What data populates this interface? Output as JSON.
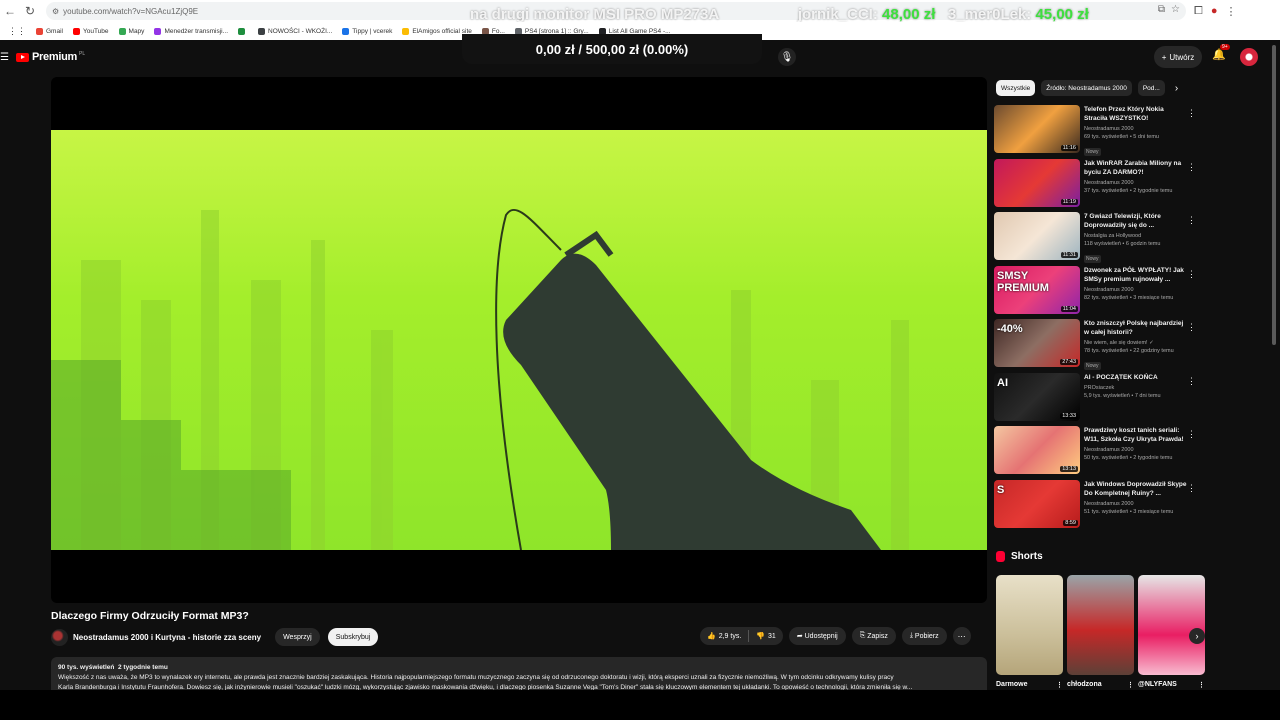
{
  "browser": {
    "url": "youtube.com/watch?v=NGAcu1ZjQ9E",
    "overlay_left": "na drugi monitor MSI PRO MP273A",
    "overlay_mid": "jornik_CCI:",
    "overlay_amount1": "48,00 zł",
    "overlay_name2": "3_mer0Lek:",
    "overlay_amount2": "45,00 zł",
    "bookmarks": [
      {
        "label": "Gmail",
        "color": "#ea4335"
      },
      {
        "label": "YouTube",
        "color": "#ff0000"
      },
      {
        "label": "Mapy",
        "color": "#34a853"
      },
      {
        "label": "Menedżer transmisji...",
        "color": "#9334e6"
      },
      {
        "label": "",
        "color": "#1e8e3e"
      },
      {
        "label": "NOWOŚCI - WKOŻI...",
        "color": "#3c4043"
      },
      {
        "label": "Tippy | vcerek",
        "color": "#1a73e8"
      },
      {
        "label": "ElAmigos official site",
        "color": "#fbbc04"
      },
      {
        "label": "Fo...",
        "color": "#795548"
      },
      {
        "label": "PS4 [strona 1] :: Gry...",
        "color": "#5f6368"
      },
      {
        "label": "List All Game PS4 -...",
        "color": "#202124"
      }
    ]
  },
  "donation": {
    "text": "0,00 zł / 500,00 zł (0.00%)"
  },
  "header": {
    "logo_text": "Premium",
    "logo_sup": "PL",
    "create_label": "Utwórz",
    "notif_badge": "9+"
  },
  "video": {
    "title": "Dlaczego Firmy Odrzuciły Format MP3?",
    "channel": "Neostradamus 2000 i Kurtyna - historie zza sceny",
    "support_label": "Wesprzyj",
    "subscribe_label": "Subskrybuj",
    "likes": "2,9 tys.",
    "dislikes": "31",
    "share_label": "Udostępnij",
    "save_label": "Zapisz",
    "download_label": "Pobierz",
    "views": "90 tys. wyświetleń",
    "age": "2 tygodnie temu",
    "description_1": "Większość z nas uważa, że MP3 to wynalazek ery internetu, ale prawda jest znacznie bardziej zaskakująca. Historia najpopularniejszego formatu muzycznego zaczyna się od odrzuconego doktoratu i wizji, którą eksperci uznali za fizycznie niemożliwą. W tym odcinku odkrywamy kulisy pracy",
    "description_2": "Karla Brandenburga i Instytutu Fraunhofera. Dowiesz się, jak inżynierowie musieli \"oszukać\" ludzki mózg, wykorzystując zjawisko maskowania dźwięku, i dlaczego piosenka Suzanne Vega \"Tom's Diner\" stała się kluczowym elementem tej układanki. To opowieść o technologii, która zmieniła się w..."
  },
  "chips": [
    "Wszystkie",
    "Źródło: Neostradamus 2000",
    "Pod..."
  ],
  "recommendations": [
    {
      "title": "Telefon Przez Który Nokia Straciła WSZYSTKO!",
      "channel": "Neostradamus 2000",
      "meta": "69 tys. wyświetleń • 5 dni temu",
      "badge": "Nowy",
      "duration": "11:16",
      "thumb_text": "",
      "thumb_bg": "linear-gradient(135deg,#6b4a2f,#f0a040 50%,#3a2a20)"
    },
    {
      "title": "Jak WinRAR Zarabia Miliony na byciu ZA DARMO?!",
      "channel": "Neostradamus 2000",
      "meta": "37 tys. wyświetleń • 2 tygodnie temu",
      "badge": "",
      "duration": "11:19",
      "thumb_text": "",
      "thumb_bg": "linear-gradient(135deg,#c2185b,#e53935 50%,#7b1fa2)"
    },
    {
      "title": "7 Gwiazd Telewizji, Które Doprowadziły się do ...",
      "channel": "Nostalgia za Hollywood",
      "meta": "118 wyświetleń • 6 godzin temu",
      "badge": "Nowy",
      "duration": "11:31",
      "thumb_text": "",
      "thumb_bg": "linear-gradient(135deg,#e0c8b0,#f5e6d6 50%,#9db4c0)"
    },
    {
      "title": "Dzwonek za PÓŁ WYPŁATY! Jak SMSy premium rujnowały ...",
      "channel": "Neostradamus 2000",
      "meta": "82 tys. wyświetleń • 3 miesiące temu",
      "badge": "",
      "duration": "11:04",
      "thumb_text": "SMSY PREMIUM",
      "thumb_bg": "linear-gradient(135deg,#d81b60,#ec407a 50%,#8e24aa)"
    },
    {
      "title": "Kto zniszczył Polskę najbardziej w całej historii?",
      "channel": "Nie wiem, ale się dowiem! ✓",
      "meta": "78 tys. wyświetleń • 22 godziny temu",
      "badge": "Nowy",
      "duration": "27:43",
      "thumb_text": "-40%",
      "thumb_bg": "linear-gradient(135deg,#3e2723,#8d6e63 50%,#c62828)"
    },
    {
      "title": "AI - POCZĄTEK KOŃCA",
      "channel": "PROsiaczek",
      "meta": "5,9 tys. wyświetleń • 7 dni temu",
      "badge": "",
      "duration": "13:33",
      "thumb_text": "AI",
      "thumb_bg": "linear-gradient(135deg,#111,#2a2a2a 50%,#000)"
    },
    {
      "title": "Prawdziwy koszt tanich seriali: W11, Szkoła Czy Ukryta Prawda!",
      "channel": "Neostradamus 2000",
      "meta": "50 tys. wyświetleń • 2 tygodnie temu",
      "badge": "",
      "duration": "13:13",
      "thumb_text": "",
      "thumb_bg": "linear-gradient(135deg,#f4c7a1,#e57373 50%,#ffcc80)"
    },
    {
      "title": "Jak Windows Doprowadził Skype Do Kompletnej Ruiny? ...",
      "channel": "Neostradamus 2000",
      "meta": "51 tys. wyświetleń • 3 miesiące temu",
      "badge": "",
      "duration": "8:59",
      "thumb_text": "S",
      "thumb_bg": "linear-gradient(135deg,#c62828,#e53935 50%,#b71c1c)"
    }
  ],
  "shorts": {
    "header": "Shorts",
    "items": [
      {
        "label": "Darmowe",
        "bg": "linear-gradient(180deg,#e8e0c8,#cbbf9a 60%,#b5a57a)"
      },
      {
        "label": "chłodzona",
        "bg": "linear-gradient(180deg,#9aa4a8,#c62828 55%,#5d4037)"
      },
      {
        "label": "@NLYFANS",
        "bg": "linear-gradient(180deg,#e6e6e6,#e91e63 60%,#f8bbd0)"
      }
    ]
  }
}
